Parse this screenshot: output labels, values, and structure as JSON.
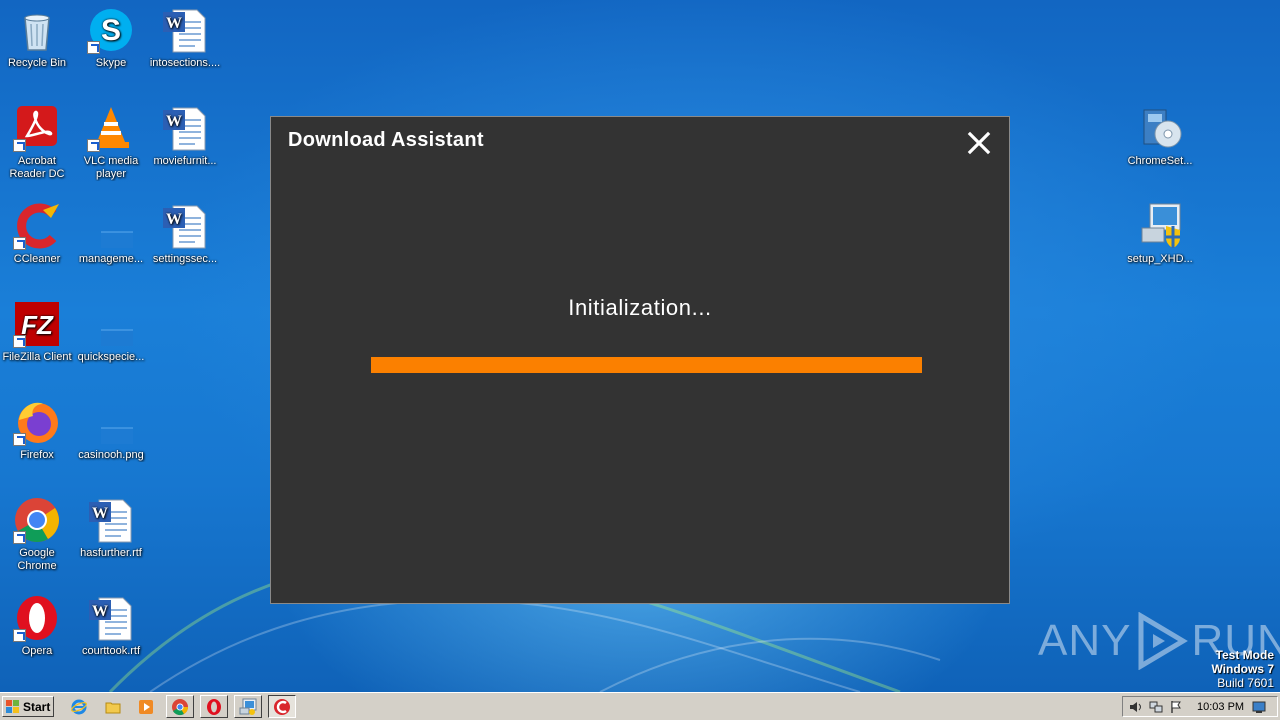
{
  "desktop": {
    "icons": [
      {
        "label": "Recycle Bin"
      },
      {
        "label": "Skype"
      },
      {
        "label": "intosections...."
      },
      {
        "label": "Acrobat Reader DC"
      },
      {
        "label": "VLC media player"
      },
      {
        "label": "moviefurnit..."
      },
      {
        "label": "CCleaner"
      },
      {
        "label": "manageme..."
      },
      {
        "label": "settingssec..."
      },
      {
        "label": "FileZilla Client"
      },
      {
        "label": "quickspecie..."
      },
      {
        "label": "Firefox"
      },
      {
        "label": "casinooh.png"
      },
      {
        "label": "Google Chrome"
      },
      {
        "label": "hasfurther.rtf"
      },
      {
        "label": "Opera"
      },
      {
        "label": "courttook.rtf"
      },
      {
        "label": "ChromeSet..."
      },
      {
        "label": "setup_XHD..."
      }
    ]
  },
  "dialog": {
    "title": "Download Assistant",
    "status": "Initialization...",
    "progress": 1.0,
    "accent_color": "#fb8000",
    "background_color": "#333333"
  },
  "watermark": {
    "left": "ANY",
    "right": "RUN"
  },
  "system": {
    "test_mode": "Test Mode",
    "os_name": "Windows 7",
    "build": "Build 7601"
  },
  "taskbar": {
    "start_label": "Start",
    "clock": "10:03 PM",
    "quick_launch": [
      "ie-icon",
      "folder-icon",
      "media-player-icon"
    ],
    "tasks": [
      "chrome-icon",
      "opera-icon",
      "installer-icon",
      "ccleaner-icon"
    ]
  }
}
